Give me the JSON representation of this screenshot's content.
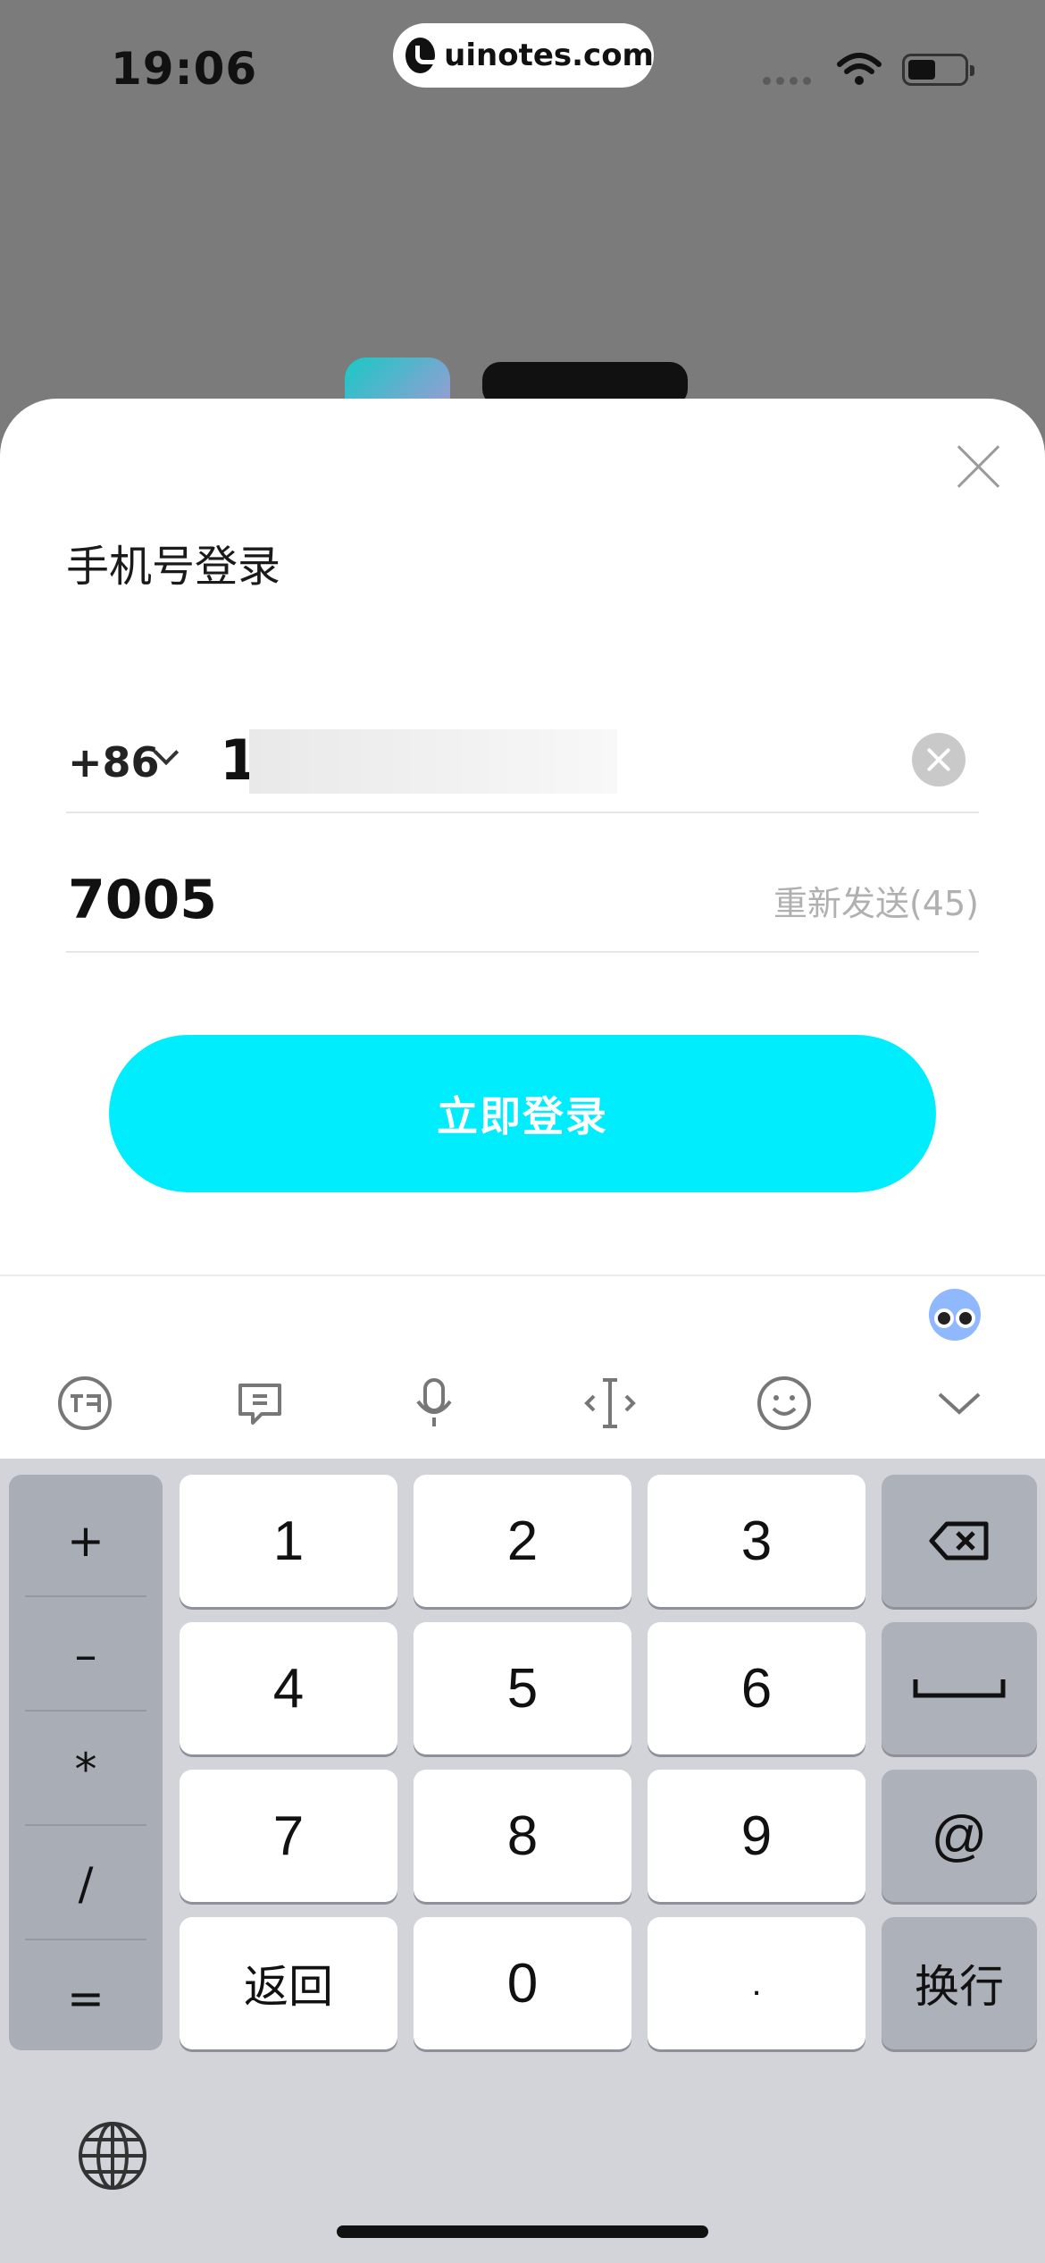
{
  "status_bar": {
    "time": "19:06",
    "url": "uinotes.com"
  },
  "login": {
    "title": "手机号登录",
    "country_code": "+86",
    "phone_value": "1",
    "code_value": "7005",
    "resend_label": "重新发送(45)",
    "submit_label": "立即登录",
    "accent_color": "#00edfd"
  },
  "keyboard_toolbar": {
    "tools": [
      "ifly-logo-icon",
      "text-edit-icon",
      "microphone-icon",
      "cursor-move-icon",
      "emoji-icon",
      "collapse-keyboard-icon"
    ]
  },
  "keyboard": {
    "symbols": [
      "+",
      "–",
      "*",
      "/",
      "="
    ],
    "digits": [
      "1",
      "2",
      "3",
      "4",
      "5",
      "6",
      "7",
      "8",
      "9"
    ],
    "back_label": "返回",
    "zero_label": "0",
    "dot_label": ".",
    "at_label": "@",
    "newline_label": "换行"
  }
}
